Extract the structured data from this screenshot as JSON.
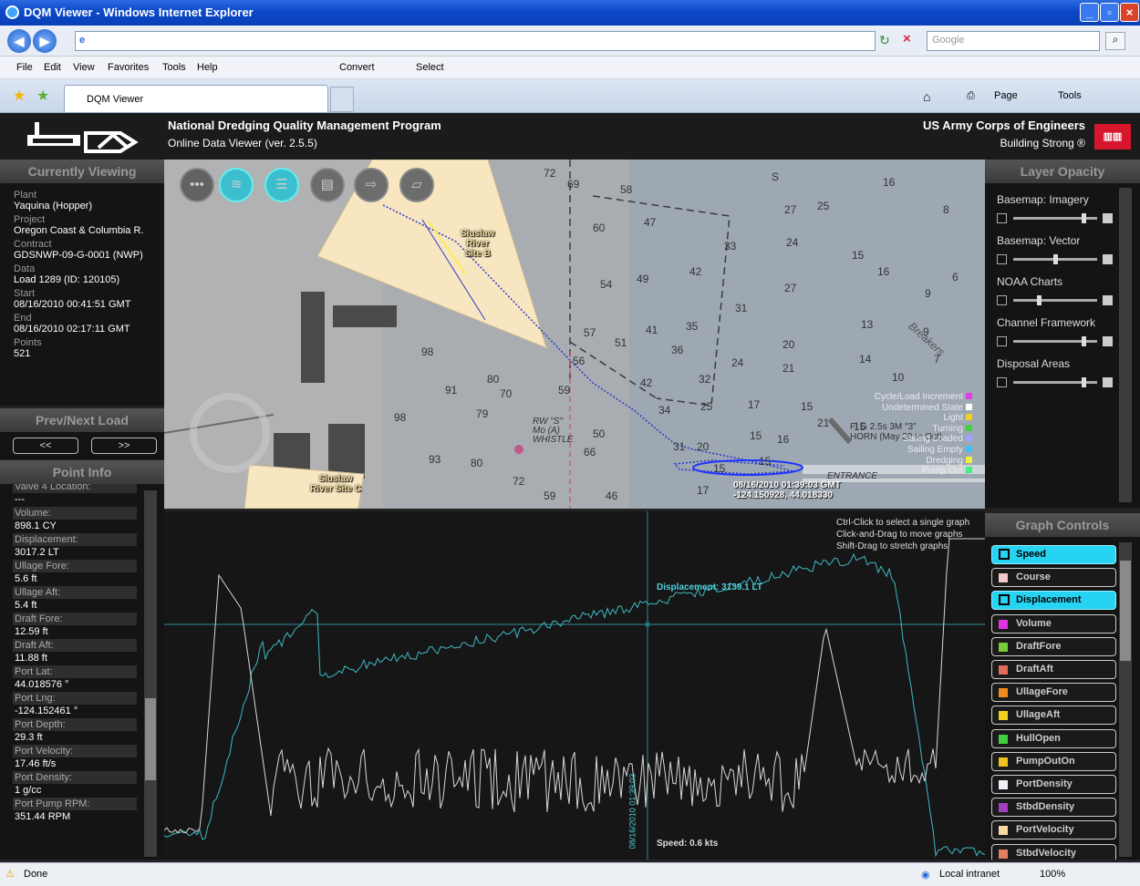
{
  "window": {
    "title": "DQM Viewer - Windows Internet Explorer",
    "search_placeholder": "Google"
  },
  "menu": [
    "File",
    "Edit",
    "View",
    "Favorites",
    "Tools",
    "Help"
  ],
  "convert": "Convert",
  "select": "Select",
  "tab": "DQM Viewer",
  "cmd": {
    "page": "Page",
    "tools": "Tools"
  },
  "header": {
    "program": "National Dredging Quality Management Program",
    "version": "Online Data Viewer (ver. 2.5.5)",
    "org": "US Army Corps of Engineers",
    "motto": "Building Strong ®"
  },
  "current": {
    "title": "Currently Viewing",
    "fields": [
      {
        "label": "Plant",
        "value": "Yaquina (Hopper)"
      },
      {
        "label": "Project",
        "value": "Oregon Coast & Columbia R."
      },
      {
        "label": "Contract",
        "value": "GDSNWP-09-G-0001 (NWP)"
      },
      {
        "label": "Data",
        "value": "Load 1289 (ID: 120105)"
      },
      {
        "label": "Start",
        "value": "08/16/2010 00:41:51 GMT"
      },
      {
        "label": "End",
        "value": "08/16/2010 02:17:11 GMT"
      },
      {
        "label": "Points",
        "value": "521"
      }
    ]
  },
  "prevnext": {
    "title": "Prev/Next Load",
    "prev": "<<",
    "next": ">>"
  },
  "pointinfo": {
    "title": "Point Info",
    "partial": "Valve 4 Location:",
    "partial_val": "---",
    "items": [
      {
        "label": "Volume:",
        "value": "898.1 CY"
      },
      {
        "label": "Displacement:",
        "value": "3017.2 LT"
      },
      {
        "label": "Ullage Fore:",
        "value": "5.6 ft"
      },
      {
        "label": "Ullage Aft:",
        "value": "5.4 ft"
      },
      {
        "label": "Draft Fore:",
        "value": "12.59 ft"
      },
      {
        "label": "Draft Aft:",
        "value": "11.88 ft"
      },
      {
        "label": "Port Lat:",
        "value": "44.018576 °"
      },
      {
        "label": "Port Lng:",
        "value": "-124.152461 °"
      },
      {
        "label": "Port Depth:",
        "value": "29.3 ft"
      },
      {
        "label": "Port Velocity:",
        "value": "17.46 ft/s"
      },
      {
        "label": "Port Density:",
        "value": "1 g/cc"
      },
      {
        "label": "Port Pump RPM:",
        "value": "351.44 RPM"
      }
    ]
  },
  "map": {
    "site_b": [
      "Siuslaw",
      "River",
      "Site B"
    ],
    "site_c": [
      "Siuslaw",
      "River Site C"
    ],
    "buoy": [
      "RW \"S\"",
      "Mo (A)",
      "WHISTLE"
    ],
    "fl": "Fl G 2.5s 3M \"3\"",
    "horn": "HORN (May 20 to Oct)",
    "entrance": "ENTRANCE",
    "breakers": "Breakers",
    "legend": [
      "Cycle/Load Increment",
      "Undetermined State",
      "Light",
      "Turning",
      "Sailing Loaded",
      "Sailing Empty",
      "Dredging",
      "Pump Out"
    ],
    "tooltip_time": "08/16/2010 01:39:03 GMT",
    "tooltip_pos": "-124.150928, 44.018330",
    "depths": [
      [
        "72",
        596,
        182
      ],
      [
        "69",
        622,
        194
      ],
      [
        "58",
        680,
        200
      ],
      [
        "S",
        846,
        186
      ],
      [
        "16",
        968,
        192
      ],
      [
        "8",
        1034,
        222
      ],
      [
        "60",
        650,
        242
      ],
      [
        "47",
        706,
        236
      ],
      [
        "27",
        860,
        222
      ],
      [
        "25",
        896,
        218
      ],
      [
        "33",
        794,
        262
      ],
      [
        "24",
        862,
        258
      ],
      [
        "15",
        934,
        272
      ],
      [
        "16",
        962,
        290
      ],
      [
        "54",
        658,
        304
      ],
      [
        "49",
        698,
        298
      ],
      [
        "42",
        756,
        290
      ],
      [
        "27",
        860,
        308
      ],
      [
        "9",
        1014,
        314
      ],
      [
        "6",
        1044,
        296
      ],
      [
        "31",
        806,
        330
      ],
      [
        "13",
        944,
        348
      ],
      [
        "57",
        640,
        357
      ],
      [
        "41",
        708,
        354
      ],
      [
        "51",
        674,
        368
      ],
      [
        "35",
        752,
        350
      ],
      [
        "36",
        736,
        376
      ],
      [
        "20",
        858,
        370
      ],
      [
        "9",
        1012,
        356
      ],
      [
        "98",
        462,
        378
      ],
      [
        "56",
        628,
        388
      ],
      [
        "24",
        802,
        390
      ],
      [
        "21",
        858,
        396
      ],
      [
        "14",
        942,
        386
      ],
      [
        "7",
        1024,
        386
      ],
      [
        "80",
        534,
        408
      ],
      [
        "91",
        488,
        420
      ],
      [
        "70",
        548,
        424
      ],
      [
        "59",
        612,
        420
      ],
      [
        "42",
        702,
        412
      ],
      [
        "32",
        766,
        408
      ],
      [
        "10",
        978,
        406
      ],
      [
        "98",
        432,
        450
      ],
      [
        "79",
        522,
        446
      ],
      [
        "34",
        722,
        442
      ],
      [
        "25",
        768,
        438
      ],
      [
        "17",
        820,
        436
      ],
      [
        "15",
        878,
        438
      ],
      [
        "21",
        896,
        456
      ],
      [
        "15",
        936,
        460
      ],
      [
        "50",
        650,
        468
      ],
      [
        "93",
        470,
        496
      ],
      [
        "80",
        516,
        500
      ],
      [
        "66",
        640,
        488
      ],
      [
        "31",
        738,
        482
      ],
      [
        "20",
        764,
        482
      ],
      [
        "15",
        822,
        470
      ],
      [
        "16",
        852,
        474
      ],
      [
        "72",
        562,
        520
      ],
      [
        "59",
        596,
        536
      ],
      [
        "46",
        664,
        536
      ],
      [
        "17",
        764,
        530
      ],
      [
        "15",
        782,
        506
      ],
      [
        "15",
        832,
        498
      ]
    ]
  },
  "graph": {
    "hints": [
      "Ctrl-Click to select a single graph",
      "Click-and-Drag to move graphs",
      "Shift-Drag to stretch graphs"
    ],
    "displacement": "Displacement: 3139.1 LT",
    "speed": "Speed: 0.6 kts",
    "cursor_time": "08/16/2010 01:39:03"
  },
  "controls": {
    "title": "Graph Controls",
    "items": [
      {
        "label": "Speed",
        "color": "#000000",
        "on": true
      },
      {
        "label": "Course",
        "color": "#f2c8c8",
        "on": false
      },
      {
        "label": "Displacement",
        "color": "#000000",
        "on": true
      },
      {
        "label": "Volume",
        "color": "#e033e0",
        "on": false
      },
      {
        "label": "DraftFore",
        "color": "#7acb3a",
        "on": false
      },
      {
        "label": "DraftAft",
        "color": "#e46a5a",
        "on": false
      },
      {
        "label": "UllageFore",
        "color": "#f08a20",
        "on": false
      },
      {
        "label": "UllageAft",
        "color": "#f0d020",
        "on": false
      },
      {
        "label": "HullOpen",
        "color": "#40d040",
        "on": false
      },
      {
        "label": "PumpOutOn",
        "color": "#f0c020",
        "on": false
      },
      {
        "label": "PortDensity",
        "color": "#f0f0f8",
        "on": false
      },
      {
        "label": "StbdDensity",
        "color": "#a040c0",
        "on": false
      },
      {
        "label": "PortVelocity",
        "color": "#f8d8a0",
        "on": false
      },
      {
        "label": "StbdVelocity",
        "color": "#e08060",
        "on": false
      }
    ]
  },
  "opacity": {
    "title": "Layer Opacity",
    "layers": [
      {
        "label": "Basemap: Imagery",
        "level": 0.85
      },
      {
        "label": "Basemap: Vector",
        "level": 0.5
      },
      {
        "label": "NOAA Charts",
        "level": 0.3
      },
      {
        "label": "Channel Framework",
        "level": 0.85
      },
      {
        "label": "Disposal Areas",
        "level": 0.85
      }
    ]
  },
  "status": {
    "left": "Done",
    "zone": "Local intranet",
    "zoom": "100%"
  }
}
